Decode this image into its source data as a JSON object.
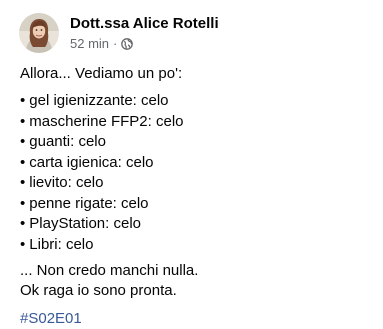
{
  "post": {
    "author": "Dott.ssa Alice Rotelli",
    "time": "52 min",
    "separator": "·",
    "privacy_icon": "globe-icon",
    "intro": "Allora... Vediamo un po':",
    "bullet": "•",
    "items": [
      "gel igienizzante: celo",
      "mascherine FFP2: celo",
      "guanti: celo",
      "carta igienica: celo",
      "lievito: celo",
      "penne rigate: celo",
      "PlayStation: celo",
      "Libri: celo"
    ],
    "outro_line1": "... Non credo manchi nulla.",
    "outro_line2": "Ok raga io sono pronta.",
    "hashtag": "#S02E01"
  },
  "colors": {
    "text": "#050505",
    "secondary": "#65676b",
    "link": "#385898"
  }
}
